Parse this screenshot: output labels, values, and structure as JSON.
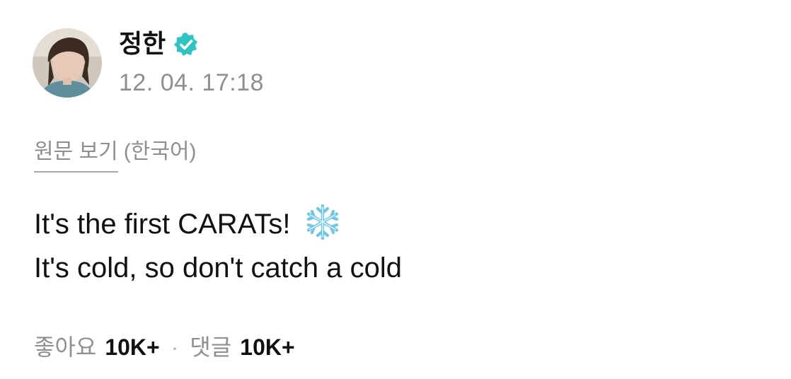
{
  "author": {
    "name": "정한",
    "verified": true,
    "verified_color": "#2ec4c4",
    "timestamp": "12. 04. 17:18"
  },
  "translation": {
    "view_original_label": "원문 보기",
    "language_label": "(한국어)"
  },
  "post": {
    "line1": "It's the first CARATs!",
    "line1_emoji": "snowflake-icon",
    "line2": "It's cold, so don't catch a cold"
  },
  "stats": {
    "likes_label": "좋아요",
    "likes_value": "10K+",
    "separator": "·",
    "comments_label": "댓글",
    "comments_value": "10K+"
  }
}
